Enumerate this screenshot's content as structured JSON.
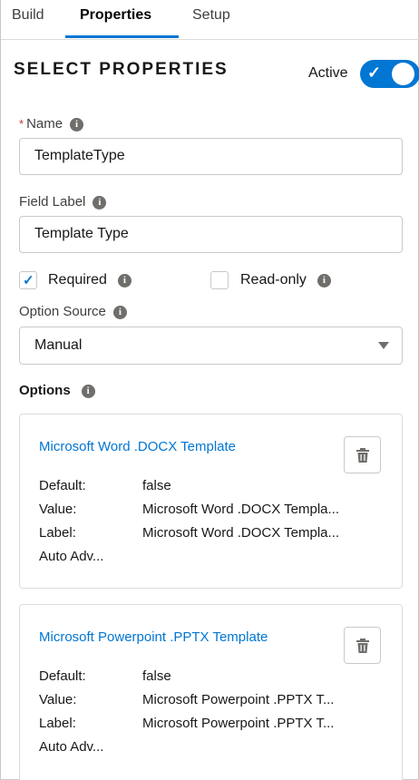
{
  "tabs": [
    {
      "label": "Build"
    },
    {
      "label": "Properties",
      "active": true
    },
    {
      "label": "Setup"
    }
  ],
  "header": {
    "title": "SELECT PROPERTIES",
    "active_label": "Active",
    "active_on": true
  },
  "name_field": {
    "required_mark": "*",
    "label": "Name",
    "value": "TemplateType"
  },
  "field_label": {
    "label": "Field Label",
    "value": "Template Type"
  },
  "required": {
    "label": "Required",
    "checked": true
  },
  "readonly": {
    "label": "Read-only",
    "checked": false
  },
  "option_source": {
    "label": "Option Source",
    "value": "Manual"
  },
  "options": {
    "title": "Options",
    "items": [
      {
        "title": "Microsoft Word .DOCX Template",
        "default_key": "Default:",
        "default_val": "false",
        "value_key": "Value:",
        "value_val": "Microsoft Word .DOCX Templa...",
        "label_key": "Label:",
        "label_val": "Microsoft Word .DOCX Templa...",
        "auto": "Auto Adv..."
      },
      {
        "title": "Microsoft Powerpoint .PPTX Template",
        "default_key": "Default:",
        "default_val": "false",
        "value_key": "Value:",
        "value_val": "Microsoft Powerpoint .PPTX T...",
        "label_key": "Label:",
        "label_val": "Microsoft Powerpoint .PPTX T...",
        "auto": "Auto Adv..."
      }
    ]
  },
  "icons": {
    "info": "info-icon",
    "trash": "trash-icon",
    "check": "check-icon",
    "caret": "chevron-down-icon"
  },
  "colors": {
    "accent": "#0176d3",
    "required": "#c23934",
    "border": "#c9c9c9"
  }
}
